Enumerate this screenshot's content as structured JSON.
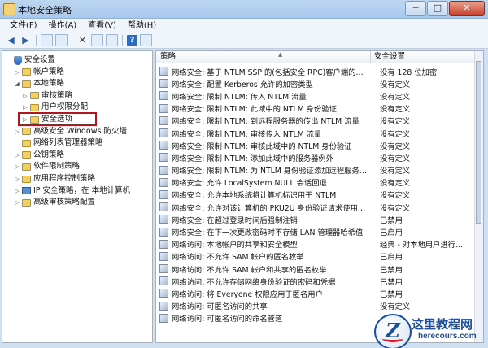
{
  "window": {
    "title": "本地安全策略",
    "min": "─",
    "max": "□",
    "close": "✕"
  },
  "menu": [
    "文件(F)",
    "操作(A)",
    "查看(V)",
    "帮助(H)"
  ],
  "tree": [
    {
      "label": "安全设置",
      "indent": 0,
      "twisty": "",
      "icon": "shield"
    },
    {
      "label": "帐户策略",
      "indent": 1,
      "twisty": "▷",
      "icon": "folder"
    },
    {
      "label": "本地策略",
      "indent": 1,
      "twisty": "◢",
      "icon": "folder"
    },
    {
      "label": "审核策略",
      "indent": 2,
      "twisty": "▷",
      "icon": "folder"
    },
    {
      "label": "用户权限分配",
      "indent": 2,
      "twisty": "▷",
      "icon": "folder"
    },
    {
      "label": "安全选项",
      "indent": 2,
      "twisty": "▷",
      "icon": "folder"
    },
    {
      "label": "高级安全 Windows 防火墙",
      "indent": 1,
      "twisty": "▷",
      "icon": "folder"
    },
    {
      "label": "网络列表管理器策略",
      "indent": 1,
      "twisty": "",
      "icon": "folder"
    },
    {
      "label": "公钥策略",
      "indent": 1,
      "twisty": "▷",
      "icon": "folder"
    },
    {
      "label": "软件限制策略",
      "indent": 1,
      "twisty": "▷",
      "icon": "folder"
    },
    {
      "label": "应用程序控制策略",
      "indent": 1,
      "twisty": "▷",
      "icon": "folder"
    },
    {
      "label": "IP 安全策略，在 本地计算机",
      "indent": 1,
      "twisty": "▷",
      "icon": "pc"
    },
    {
      "label": "高级审核策略配置",
      "indent": 1,
      "twisty": "▷",
      "icon": "folder"
    }
  ],
  "list": {
    "col_policy": "策略",
    "col_setting": "安全设置",
    "rows": [
      {
        "name": "网络安全: 基于 NTLM SSP 的(包括安全 RPC)客户端的最小...",
        "value": "没有 128 位加密"
      },
      {
        "name": "网络安全: 配置 Kerberos 允许的加密类型",
        "value": "没有定义"
      },
      {
        "name": "网络安全: 限制 NTLM: 传入 NTLM 流量",
        "value": "没有定义"
      },
      {
        "name": "网络安全: 限制 NTLM: 此域中的 NTLM 身份验证",
        "value": "没有定义"
      },
      {
        "name": "网络安全: 限制 NTLM: 到远程服务器的传出 NTLM 流量",
        "value": "没有定义"
      },
      {
        "name": "网络安全: 限制 NTLM: 审核传入 NTLM 流量",
        "value": "没有定义"
      },
      {
        "name": "网络安全: 限制 NTLM: 审核此域中的 NTLM 身份验证",
        "value": "没有定义"
      },
      {
        "name": "网络安全: 限制 NTLM: 添加此域中的服务器例外",
        "value": "没有定义"
      },
      {
        "name": "网络安全: 限制 NTLM: 为 NTLM 身份验证添加远程服务器...",
        "value": "没有定义"
      },
      {
        "name": "网络安全: 允许 LocalSystem NULL 会话回退",
        "value": "没有定义"
      },
      {
        "name": "网络安全: 允许本地系统将计算机标识用于 NTLM",
        "value": "没有定义"
      },
      {
        "name": "网络安全: 允许对该计算机的 PKU2U 身份验证请求使用联...",
        "value": "没有定义"
      },
      {
        "name": "网络安全: 在超过登录时间后强制注销",
        "value": "已禁用"
      },
      {
        "name": "网络安全: 在下一次更改密码时不存储 LAN 管理器哈希值",
        "value": "已启用"
      },
      {
        "name": "网络访问: 本地帐户的共享和安全模型",
        "value": "经典 - 对本地用户进行..."
      },
      {
        "name": "网络访问: 不允许 SAM 帐户的匿名枚举",
        "value": "已启用"
      },
      {
        "name": "网络访问: 不允许 SAM 帐户和共享的匿名枚举",
        "value": "已禁用"
      },
      {
        "name": "网络访问: 不允许存储网络身份验证的密码和凭据",
        "value": "已禁用"
      },
      {
        "name": "网络访问: 将 Everyone 权限应用于匿名用户",
        "value": "已禁用"
      },
      {
        "name": "网络访问: 可匿名访问的共享",
        "value": "没有定义"
      },
      {
        "name": "网络访问: 可匿名访问的命名管道",
        "value": ""
      }
    ]
  },
  "watermark": {
    "logo_letter": "Z",
    "name": "这里教程网",
    "url": "herecours.com"
  }
}
